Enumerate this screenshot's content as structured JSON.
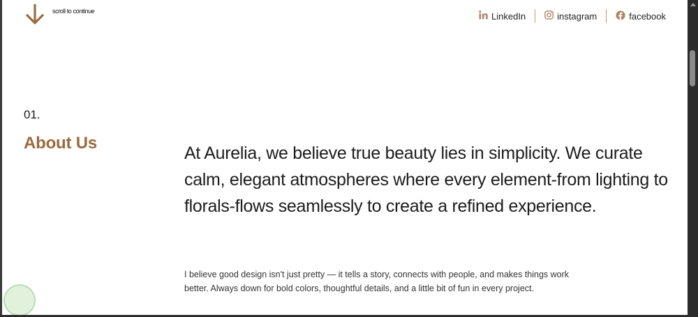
{
  "header": {
    "scroll_label": "scroll to continue",
    "social": [
      {
        "label": "LinkedIn",
        "icon": "linkedin-icon"
      },
      {
        "label": "instagram",
        "icon": "instagram-icon"
      },
      {
        "label": "facebook",
        "icon": "facebook-icon"
      }
    ]
  },
  "about": {
    "number": "01.",
    "title": "About Us",
    "lead": "At Aurelia, we believe true beauty lies in simplicity. We curate calm, elegant atmospheres where every element-from lighting to florals-flows seamlessly to create a refined experience.",
    "body": "I believe good design isn't just pretty — it tells a story, connects with people, and makes things work better. Always down for bold colors, thoughtful details, and a little bit of fun in every project."
  },
  "colors": {
    "accent": "#9a6a3e",
    "divider": "#c49a78",
    "background": "#ffffff"
  }
}
